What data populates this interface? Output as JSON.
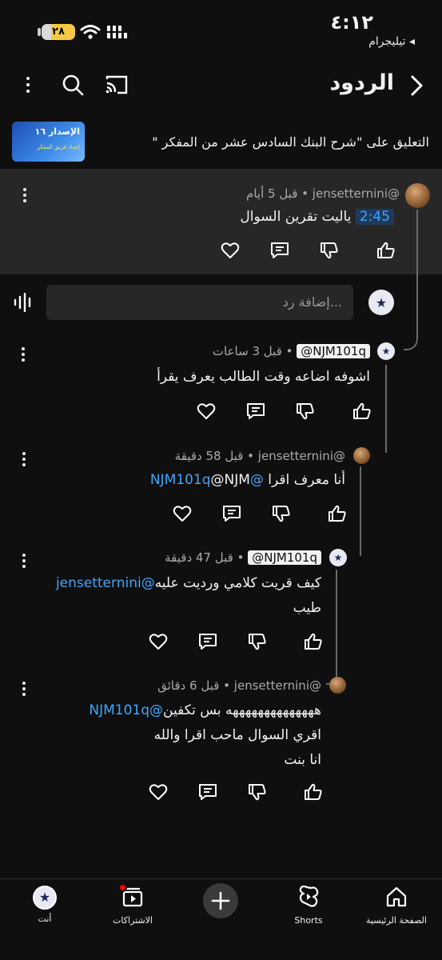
{
  "status_bar": {
    "time": "٤:١٢",
    "back_app": "◂ تيليجرام",
    "battery": "٢٨"
  },
  "header": {
    "title": "الردود"
  },
  "context": {
    "text": "التعليق على \"شرح البنك السادس عشر من المفكر \"",
    "thumb_title": "الإصدار ١٦",
    "thumb_sub": "إعداد فريق المفكر"
  },
  "main_comment": {
    "author": "@jensetternini",
    "time": "قبل 5 أيام",
    "timestamp": "2:45",
    "text": "ياليت تقرين السوال"
  },
  "reply_input": {
    "placeholder": "إضافة رد..."
  },
  "replies": [
    {
      "author": "@NJM101q",
      "time": "قبل 3 ساعات",
      "text": "اشوفه اضاعه وقت الطالب يعرف يقرأ"
    },
    {
      "author": "@jensetternini",
      "time": "قبل 58 دقيقة",
      "text_prefix": "أنا معرف اقرا ",
      "mention": "@NJM101q",
      "text_suffix": "@NJM"
    },
    {
      "author": "@NJM101q",
      "time": "قبل 47 دقيقة",
      "text_prefix": "كيف قريت كلامي ورديت عليه",
      "mention": "@jensetternini",
      "line2": "طيب"
    },
    {
      "author": "@jensetternini",
      "time": "قبل 6 دقائق",
      "text_prefix": "ههههههههههههههه بس تكفين",
      "mention": "@NJM101q",
      "line2": "اقري السوال ماحب اقرا والله",
      "line3": "انا بنت"
    }
  ],
  "separator": "•",
  "bottom_nav": {
    "home": "الصفحة الرئيسية",
    "shorts": "Shorts",
    "subscriptions": "الاشتراكات",
    "you": "أنت"
  },
  "colors": {
    "background": "#0f0f0f",
    "highlight": "#272727",
    "link": "#3ea6ff",
    "notification": "#ff0000"
  }
}
